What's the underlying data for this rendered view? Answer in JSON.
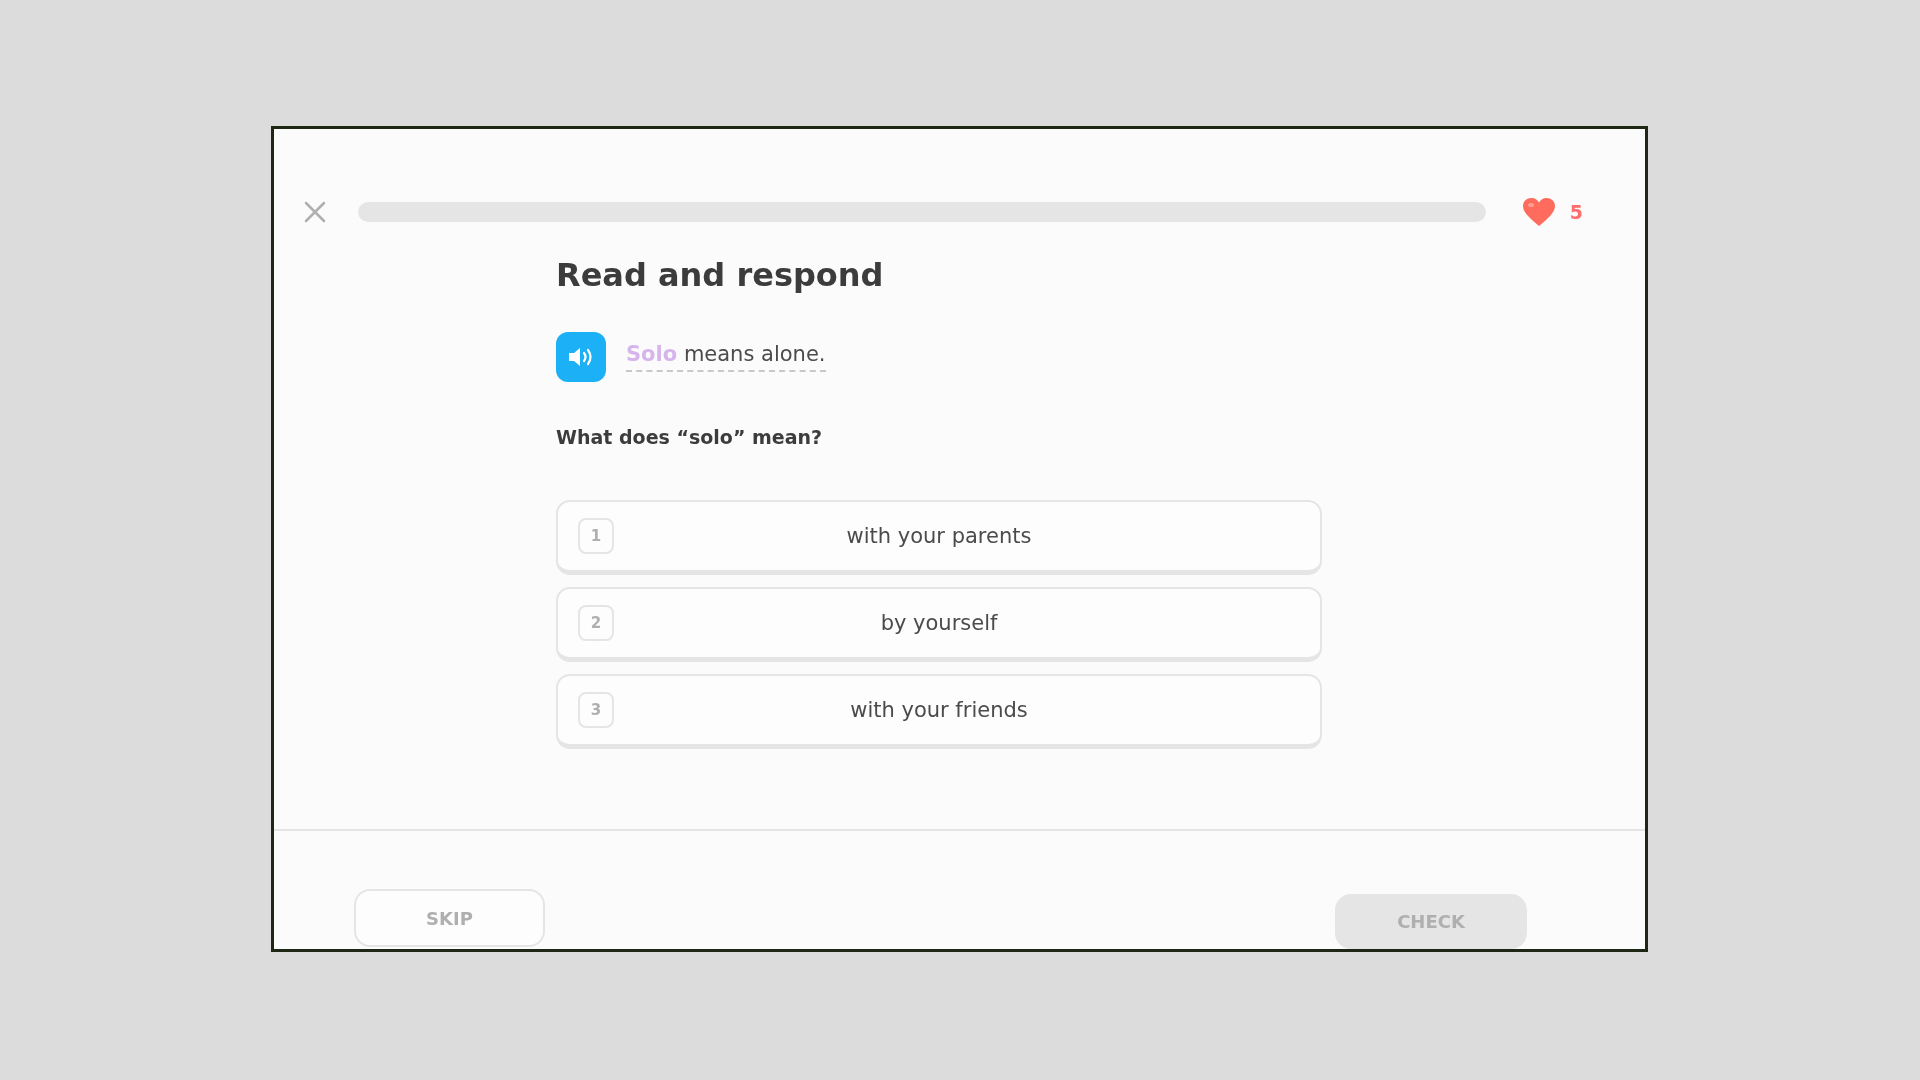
{
  "header": {
    "progress": {
      "level": 0
    },
    "hearts": "5"
  },
  "title": "Read and respond",
  "prompt": {
    "highlight": "Solo",
    "rest": "means alone."
  },
  "question": "What does “solo” mean?",
  "options": [
    {
      "number": "1",
      "label": "with your parents",
      "selected": false
    },
    {
      "number": "2",
      "label": "by yourself",
      "selected": false
    },
    {
      "number": "3",
      "label": "with your friends",
      "selected": false
    }
  ],
  "footer": {
    "skip": "SKIP",
    "check": {
      "label": "CHECK",
      "disabled": true
    }
  }
}
